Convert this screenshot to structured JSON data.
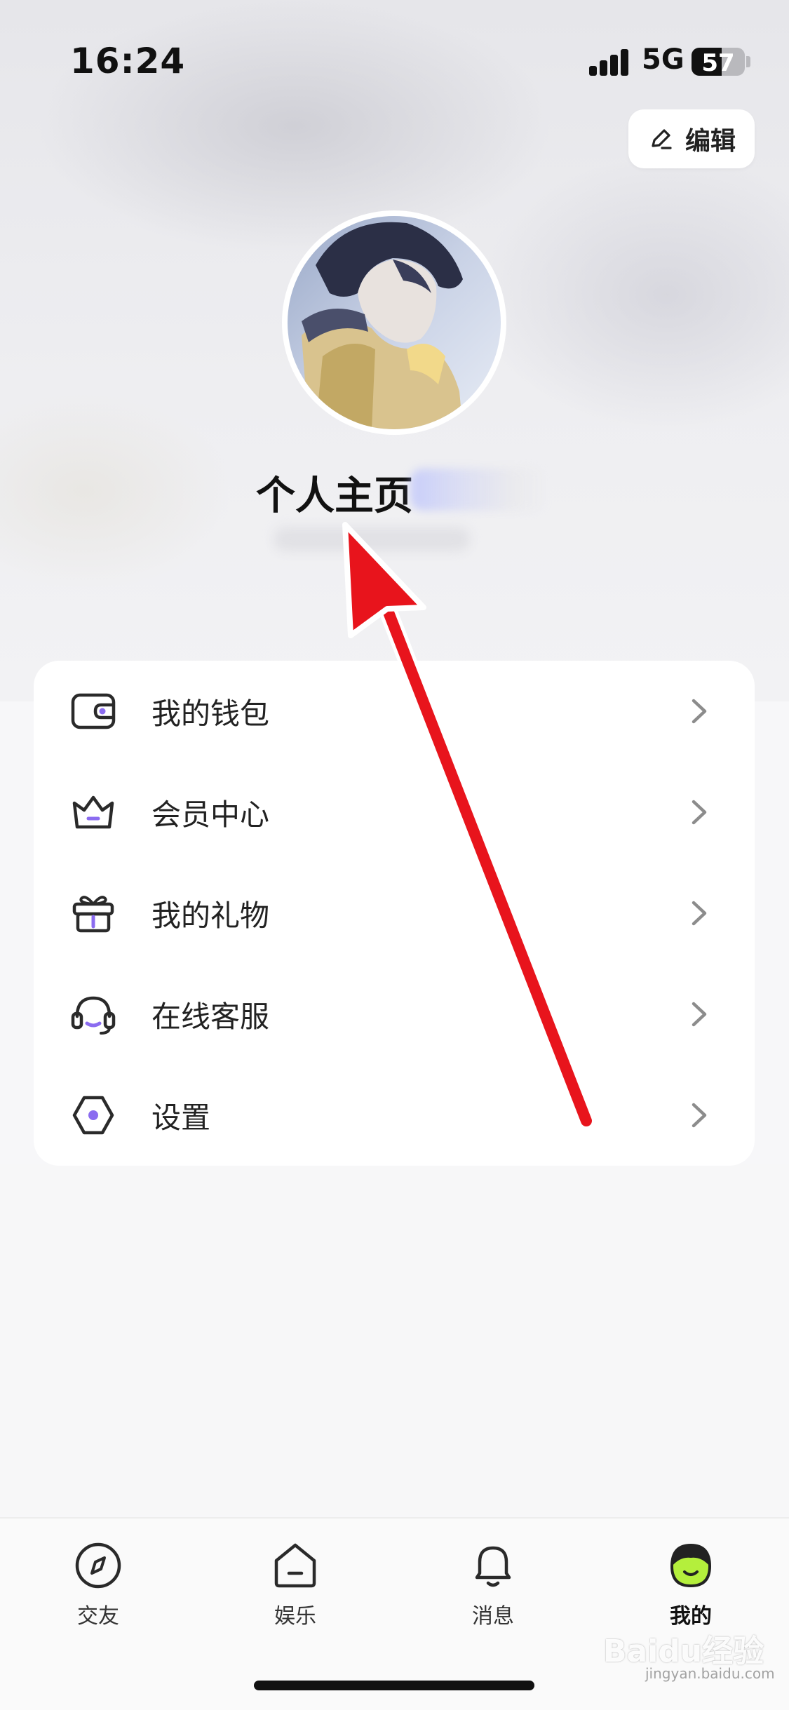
{
  "status_bar": {
    "time": "16:24",
    "network": "5G",
    "battery": "57",
    "battery_level": 0.57
  },
  "header": {
    "edit_label": "编辑"
  },
  "profile": {
    "name": "个人主页"
  },
  "menu": {
    "items": [
      {
        "label": "我的钱包",
        "icon": "wallet-icon"
      },
      {
        "label": "会员中心",
        "icon": "crown-icon"
      },
      {
        "label": "我的礼物",
        "icon": "gift-icon"
      },
      {
        "label": "在线客服",
        "icon": "headset-icon"
      },
      {
        "label": "设置",
        "icon": "settings-icon"
      }
    ]
  },
  "tabbar": {
    "tabs": [
      {
        "label": "交友",
        "icon": "compass-icon",
        "active": false
      },
      {
        "label": "娱乐",
        "icon": "home-icon",
        "active": false
      },
      {
        "label": "消息",
        "icon": "bell-icon",
        "active": false
      },
      {
        "label": "我的",
        "icon": "profile-face-icon",
        "active": true
      }
    ]
  },
  "watermark": {
    "text": "Baidu经验",
    "sub": "jingyan.baidu.com"
  },
  "colors": {
    "accent_purple": "#8b6cf0",
    "active_green": "#b4ef3c",
    "arrow_red": "#e8141c"
  }
}
